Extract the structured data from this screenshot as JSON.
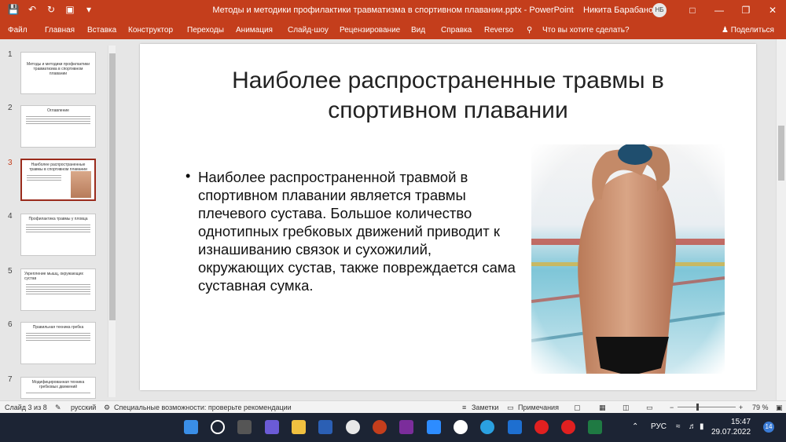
{
  "titlebar": {
    "title": "Методы и методики профилактики травматизма в спортивном плавании.pptx  -  PowerPoint",
    "user": "Никита Барабанов",
    "avatar": "НБ"
  },
  "ribbon": {
    "tabs": [
      "Файл",
      "Главная",
      "Вставка",
      "Конструктор",
      "Переходы",
      "Анимация",
      "Слайд-шоу",
      "Рецензирование",
      "Вид",
      "Справка",
      "Reverso"
    ],
    "tellme": "Что вы хотите сделать?",
    "share": "Поделиться"
  },
  "thumbnails": [
    {
      "num": "1",
      "title": "Методы и методики профилактики травматизма в спортивном плавании"
    },
    {
      "num": "2",
      "title": "Оглавление"
    },
    {
      "num": "3",
      "title": "Наиболее распространенные травмы в спортивном плавании"
    },
    {
      "num": "4",
      "title": "Профилактика травмы у пловца"
    },
    {
      "num": "5",
      "title": "Укрепление мышц, окружающих сустав"
    },
    {
      "num": "6",
      "title": "Правильная техника гребка"
    },
    {
      "num": "7",
      "title": "Модифицированная техника гребковых движений"
    }
  ],
  "slide": {
    "title": "Наиболее распространенные травмы в спортивном плавании",
    "bullet": "Наиболее распространенной травмой в спортивном плавании является травмы плечевого сустава. Большое количество однотипных гребковых движений приводит к изнашиванию связок и сухожилий, окружающих сустав, также повреждается сама суставная сумка."
  },
  "statusbar": {
    "slide_info": "Слайд 3 из 8",
    "language": "русский",
    "accessibility": "Специальные возможности: проверьте рекомендации",
    "notes": "Заметки",
    "comments": "Примечания",
    "zoom": "79 %"
  },
  "taskbar": {
    "lang": "РУС",
    "time": "15:47",
    "date": "29.07.2022",
    "notifications": "14"
  },
  "colors": {
    "accent": "#c43e1c",
    "taskbar": "#1c2434"
  }
}
